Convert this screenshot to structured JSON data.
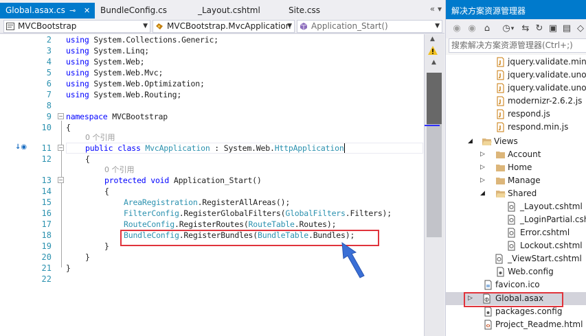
{
  "tabs": [
    {
      "label": "Global.asax.cs",
      "active": true
    },
    {
      "label": "BundleConfig.cs",
      "active": false
    },
    {
      "label": "_Layout.cshtml",
      "active": false
    },
    {
      "label": "Site.css",
      "active": false
    }
  ],
  "nav": {
    "project": "MVCBootstrap",
    "type": "MVCBootstrap.MvcApplication",
    "member": "Application_Start()"
  },
  "editor": {
    "reference_hint": "0 个引用",
    "lines": [
      {
        "n": "2"
      },
      {
        "n": "3"
      },
      {
        "n": "4"
      },
      {
        "n": "5"
      },
      {
        "n": "6"
      },
      {
        "n": "7"
      },
      {
        "n": "8"
      },
      {
        "n": "9"
      },
      {
        "n": "10"
      },
      {
        "n": "11"
      },
      {
        "n": "12"
      },
      {
        "n": "13"
      },
      {
        "n": "14"
      },
      {
        "n": "15"
      },
      {
        "n": "16"
      },
      {
        "n": "17"
      },
      {
        "n": "18"
      },
      {
        "n": "19"
      },
      {
        "n": "20"
      },
      {
        "n": "21"
      },
      {
        "n": "22"
      }
    ],
    "code": {
      "l2_kw": "using",
      "l2_rest": " System.Collections.Generic;",
      "l3_kw": "using",
      "l3_rest": " System.Linq;",
      "l4_kw": "using",
      "l4_rest": " System.Web;",
      "l5_kw": "using",
      "l5_rest": " System.Web.Mvc;",
      "l6_kw": "using",
      "l6_rest": " System.Web.Optimization;",
      "l7_kw": "using",
      "l7_rest": " System.Web.Routing;",
      "l9_kw": "namespace",
      "l9_rest": " MVCBootstrap",
      "l10": "{",
      "l11_kw1": "public",
      "l11_kw2": " class",
      "l11_ty": " MvcApplication",
      "l11_mid": " : System.Web.",
      "l11_ty2": "HttpApplication",
      "l12": "{",
      "l13_kw1": "protected",
      "l13_kw2": " void",
      "l13_rest": " Application_Start()",
      "l14": "{",
      "l15_ty": "AreaRegistration",
      "l15_rest": ".RegisterAllAreas();",
      "l16_ty": "FilterConfig",
      "l16_mid": ".RegisterGlobalFilters(",
      "l16_ty2": "GlobalFilters",
      "l16_rest": ".Filters);",
      "l17_ty": "RouteConfig",
      "l17_mid": ".RegisterRoutes(",
      "l17_ty2": "RouteTable",
      "l17_rest": ".Routes);",
      "l18_ty": "BundleConfig",
      "l18_mid": ".RegisterBundles(",
      "l18_ty2": "BundleTable",
      "l18_rest": ".Bundles);",
      "l19": "}",
      "l20": "}",
      "l21": "}"
    }
  },
  "solution_explorer": {
    "title": "解决方案资源管理器",
    "search_placeholder": "搜索解决方案资源管理器(Ctrl+;)",
    "items": [
      {
        "label": "jquery.validate.min.js",
        "icon": "js-file-icon"
      },
      {
        "label": "jquery.validate.unobtrusive.js",
        "icon": "js-file-icon"
      },
      {
        "label": "jquery.validate.unobtrusive.min.js",
        "icon": "js-file-icon"
      },
      {
        "label": "modernizr-2.6.2.js",
        "icon": "js-file-icon"
      },
      {
        "label": "respond.js",
        "icon": "js-file-icon"
      },
      {
        "label": "respond.min.js",
        "icon": "js-file-icon"
      },
      {
        "label": "Views",
        "icon": "folder-open-icon"
      },
      {
        "label": "Account",
        "icon": "folder-icon"
      },
      {
        "label": "Home",
        "icon": "folder-icon"
      },
      {
        "label": "Manage",
        "icon": "folder-icon"
      },
      {
        "label": "Shared",
        "icon": "folder-open-icon"
      },
      {
        "label": "_Layout.cshtml",
        "icon": "razor-file-icon"
      },
      {
        "label": "_LoginPartial.cshtml",
        "icon": "razor-file-icon"
      },
      {
        "label": "Error.cshtml",
        "icon": "razor-file-icon"
      },
      {
        "label": "Lockout.cshtml",
        "icon": "razor-file-icon"
      },
      {
        "label": "_ViewStart.cshtml",
        "icon": "razor-file-icon"
      },
      {
        "label": "Web.config",
        "icon": "config-file-icon"
      },
      {
        "label": "favicon.ico",
        "icon": "image-file-icon"
      },
      {
        "label": "Global.asax",
        "icon": "asax-file-icon"
      },
      {
        "label": "packages.config",
        "icon": "config-file-icon"
      },
      {
        "label": "Project_Readme.html",
        "icon": "html-file-icon"
      }
    ]
  },
  "colors": {
    "accent": "#007acc",
    "highlight_box": "#e0333b",
    "keyword": "#0000ff",
    "type": "#2b91af"
  }
}
